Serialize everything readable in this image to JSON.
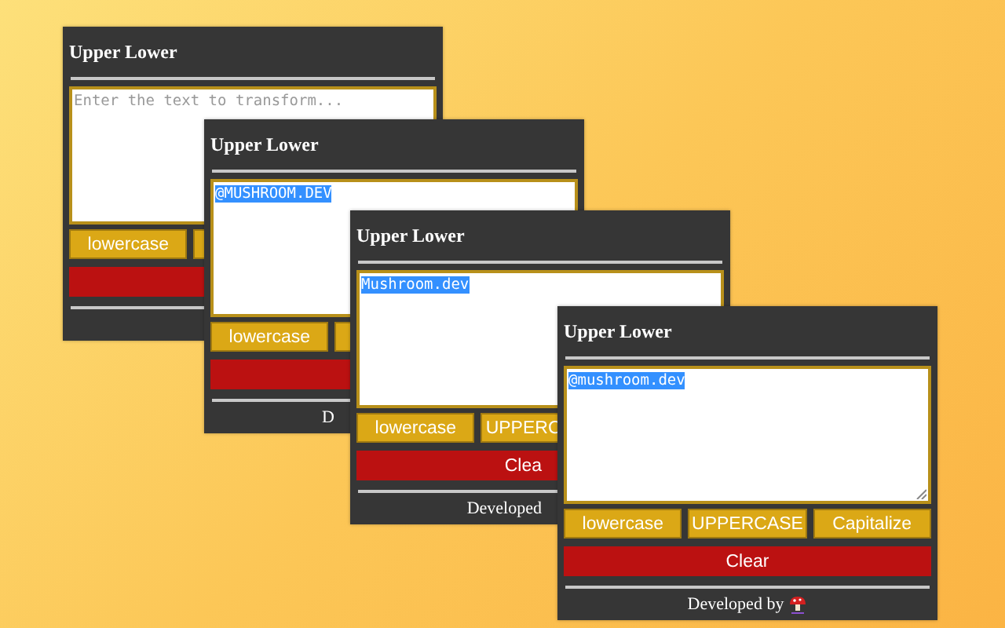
{
  "windows": [
    {
      "title": "Upper Lower",
      "text": {
        "placeholder": "Enter the text to transform..."
      },
      "buttons": [
        {
          "kind": "case",
          "label": "lowercase"
        },
        {
          "kind": "case"
        },
        {
          "kind": "danger"
        }
      ]
    },
    {
      "title": "Upper Lower",
      "text": {
        "value": "@MUSHROOM.DEV",
        "selected": true
      },
      "buttons": [
        {
          "kind": "case",
          "label": "lowercase"
        },
        {
          "kind": "case"
        },
        {
          "kind": "danger"
        }
      ],
      "footer": {
        "text": "D"
      }
    },
    {
      "title": "Upper Lower",
      "text": {
        "value": "Mushroom.dev",
        "selected": true
      },
      "buttons": [
        {
          "kind": "case",
          "label": "lowercase"
        },
        {
          "kind": "case",
          "label": "UPPERC"
        },
        {
          "kind": "danger",
          "label": "Clea"
        }
      ],
      "footer": {
        "text": "Developed"
      }
    },
    {
      "title": "Upper Lower",
      "text": {
        "value": "@mushroom.dev",
        "selected": true
      },
      "buttons": [
        {
          "kind": "case",
          "label": "lowercase"
        },
        {
          "kind": "case",
          "label": "UPPERCASE"
        },
        {
          "kind": "case",
          "label": "Capitalize"
        },
        {
          "kind": "danger",
          "label": "Clear"
        }
      ],
      "footer": {
        "text": "Developed by",
        "logo": true
      }
    }
  ]
}
